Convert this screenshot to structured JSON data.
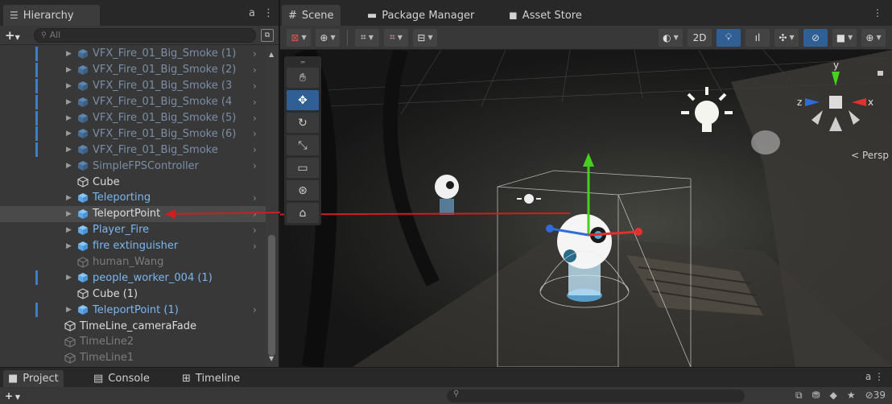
{
  "hierarchy": {
    "tab_label": "Hierarchy",
    "lock_icon": "lock-icon",
    "menu_icon": "kebab-menu-icon",
    "add_label": "+",
    "search_placeholder": "All",
    "items": [
      {
        "label": "VFX_Fire_01_Big_Smoke (1)",
        "style": "dim",
        "expand": true,
        "indent": 1,
        "chevron": true,
        "bar": true
      },
      {
        "label": "VFX_Fire_01_Big_Smoke (2)",
        "style": "dim",
        "expand": true,
        "indent": 1,
        "chevron": true,
        "bar": true
      },
      {
        "label": "VFX_Fire_01_Big_Smoke (3",
        "style": "dim",
        "expand": true,
        "indent": 1,
        "chevron": true,
        "bar": true
      },
      {
        "label": "VFX_Fire_01_Big_Smoke (4",
        "style": "dim",
        "expand": true,
        "indent": 1,
        "chevron": true,
        "bar": true
      },
      {
        "label": "VFX_Fire_01_Big_Smoke (5)",
        "style": "dim",
        "expand": true,
        "indent": 1,
        "chevron": true,
        "bar": true
      },
      {
        "label": "VFX_Fire_01_Big_Smoke (6)",
        "style": "dim",
        "expand": true,
        "indent": 1,
        "chevron": true,
        "bar": true
      },
      {
        "label": "VFX_Fire_01_Big_Smoke",
        "style": "dim",
        "expand": true,
        "indent": 1,
        "chevron": true,
        "bar": true
      },
      {
        "label": "SimpleFPSController",
        "style": "dim",
        "expand": true,
        "indent": 1,
        "chevron": true,
        "bar": false
      },
      {
        "label": "Cube",
        "style": "normal",
        "expand": false,
        "indent": 1,
        "chevron": false,
        "bar": false,
        "plain": true
      },
      {
        "label": "Teleporting",
        "style": "prefab",
        "expand": true,
        "indent": 1,
        "chevron": true,
        "bar": false
      },
      {
        "label": "TeleportPoint",
        "style": "normal",
        "expand": true,
        "indent": 1,
        "chevron": true,
        "bar": false,
        "selected": true
      },
      {
        "label": "Player_Fire",
        "style": "prefab",
        "expand": true,
        "indent": 1,
        "chevron": true,
        "bar": false
      },
      {
        "label": "fire extinguisher",
        "style": "prefab",
        "expand": true,
        "indent": 1,
        "chevron": true,
        "bar": false
      },
      {
        "label": "human_Wang",
        "style": "gray",
        "expand": false,
        "indent": 1,
        "chevron": false,
        "bar": false,
        "plain": true
      },
      {
        "label": "people_worker_004 (1)",
        "style": "prefab",
        "expand": true,
        "indent": 1,
        "chevron": false,
        "bar": true
      },
      {
        "label": "Cube (1)",
        "style": "normal",
        "expand": false,
        "indent": 1,
        "chevron": false,
        "bar": false,
        "plain": true
      },
      {
        "label": "TeleportPoint (1)",
        "style": "prefab",
        "expand": true,
        "indent": 1,
        "chevron": true,
        "bar": true
      },
      {
        "label": "TimeLine_cameraFade",
        "style": "normal",
        "expand": false,
        "indent": 0,
        "chevron": false,
        "bar": false,
        "plain": true
      },
      {
        "label": "TimeLine2",
        "style": "gray",
        "expand": false,
        "indent": 0,
        "chevron": false,
        "bar": false,
        "plain": true
      },
      {
        "label": "TimeLine1",
        "style": "gray",
        "expand": false,
        "indent": 0,
        "chevron": false,
        "bar": false,
        "plain": true
      }
    ]
  },
  "scene": {
    "tabs": [
      {
        "label": "Scene",
        "icon": "grid-icon",
        "active": true
      },
      {
        "label": "Package Manager",
        "icon": "package-icon",
        "active": false
      },
      {
        "label": "Asset Store",
        "icon": "store-bag-icon",
        "active": false
      }
    ],
    "toolbar_2d": "2D",
    "persp_label": "< Persp",
    "gizmo_axes": {
      "x": "x",
      "y": "y",
      "z": "z"
    },
    "colors": {
      "accent_blue": "#2f5f94",
      "arrow_red": "#cc1f1f",
      "axis_green": "#46d11e",
      "axis_red": "#e03030",
      "axis_blue": "#2f6bd9"
    }
  },
  "project": {
    "tabs": [
      {
        "label": "Project",
        "icon": "folder-icon",
        "active": true
      },
      {
        "label": "Console",
        "icon": "console-icon",
        "active": false
      },
      {
        "label": "Timeline",
        "icon": "timeline-icon",
        "active": false
      }
    ],
    "add_label": "+",
    "hidden_count": "39"
  }
}
